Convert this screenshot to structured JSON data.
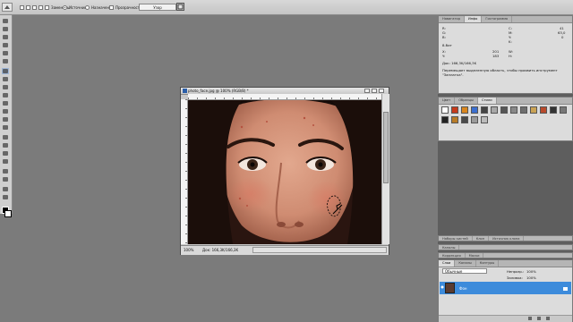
{
  "options_bar": {
    "check1_label": "Заменить",
    "radio1_label": "Источник",
    "radio2_label": "Назначение",
    "check2_label": "Прозрачность",
    "mode_value": "Узор"
  },
  "document": {
    "title": "photo_face.jpg @ 100% (RGB/8) *",
    "zoom": "100%",
    "doc_size": "Док: 166,3K/166,3K"
  },
  "panels": {
    "info_tabs": [
      "Навигатор",
      "Инфо",
      "Гистограмма"
    ],
    "info_values": {
      "r": "R:",
      "g": "G:",
      "b": "B:",
      "c": "C:",
      "m": "M:",
      "y": "Y:",
      "k": "K:",
      "bit": "8-бит",
      "x": "X:",
      "y2": "Y:",
      "w": "W:",
      "h": "H:",
      "x_val": "201",
      "y_val": "183",
      "c_val": "41",
      "m_val": "63,0",
      "y_val2": "0"
    },
    "doc_line": "Док: 166,3K/166,3K",
    "hint": "Перемещает выделенную область, чтобы проявить инструмент \"Заплатка\".",
    "styles_tabs": [
      "Цвет",
      "Образцы",
      "Стили"
    ],
    "actions_tabs": [
      "Коррекция",
      "Маски"
    ],
    "mini_tabs": [
      "Наборы кистей",
      "Клон",
      "Источник клона"
    ],
    "channels_tab": "Каналы",
    "layers_tabs": [
      "Слои",
      "Каналы",
      "Контуры"
    ],
    "blend_mode": "Обычные",
    "opacity_label": "Непрозр.:",
    "opacity_value": "100%",
    "fill_label": "Заливка:",
    "fill_value": "100%",
    "layer_name": "Фон"
  },
  "colors": {
    "accent": "#3d8bdb",
    "workspace": "#7b7b7b"
  }
}
